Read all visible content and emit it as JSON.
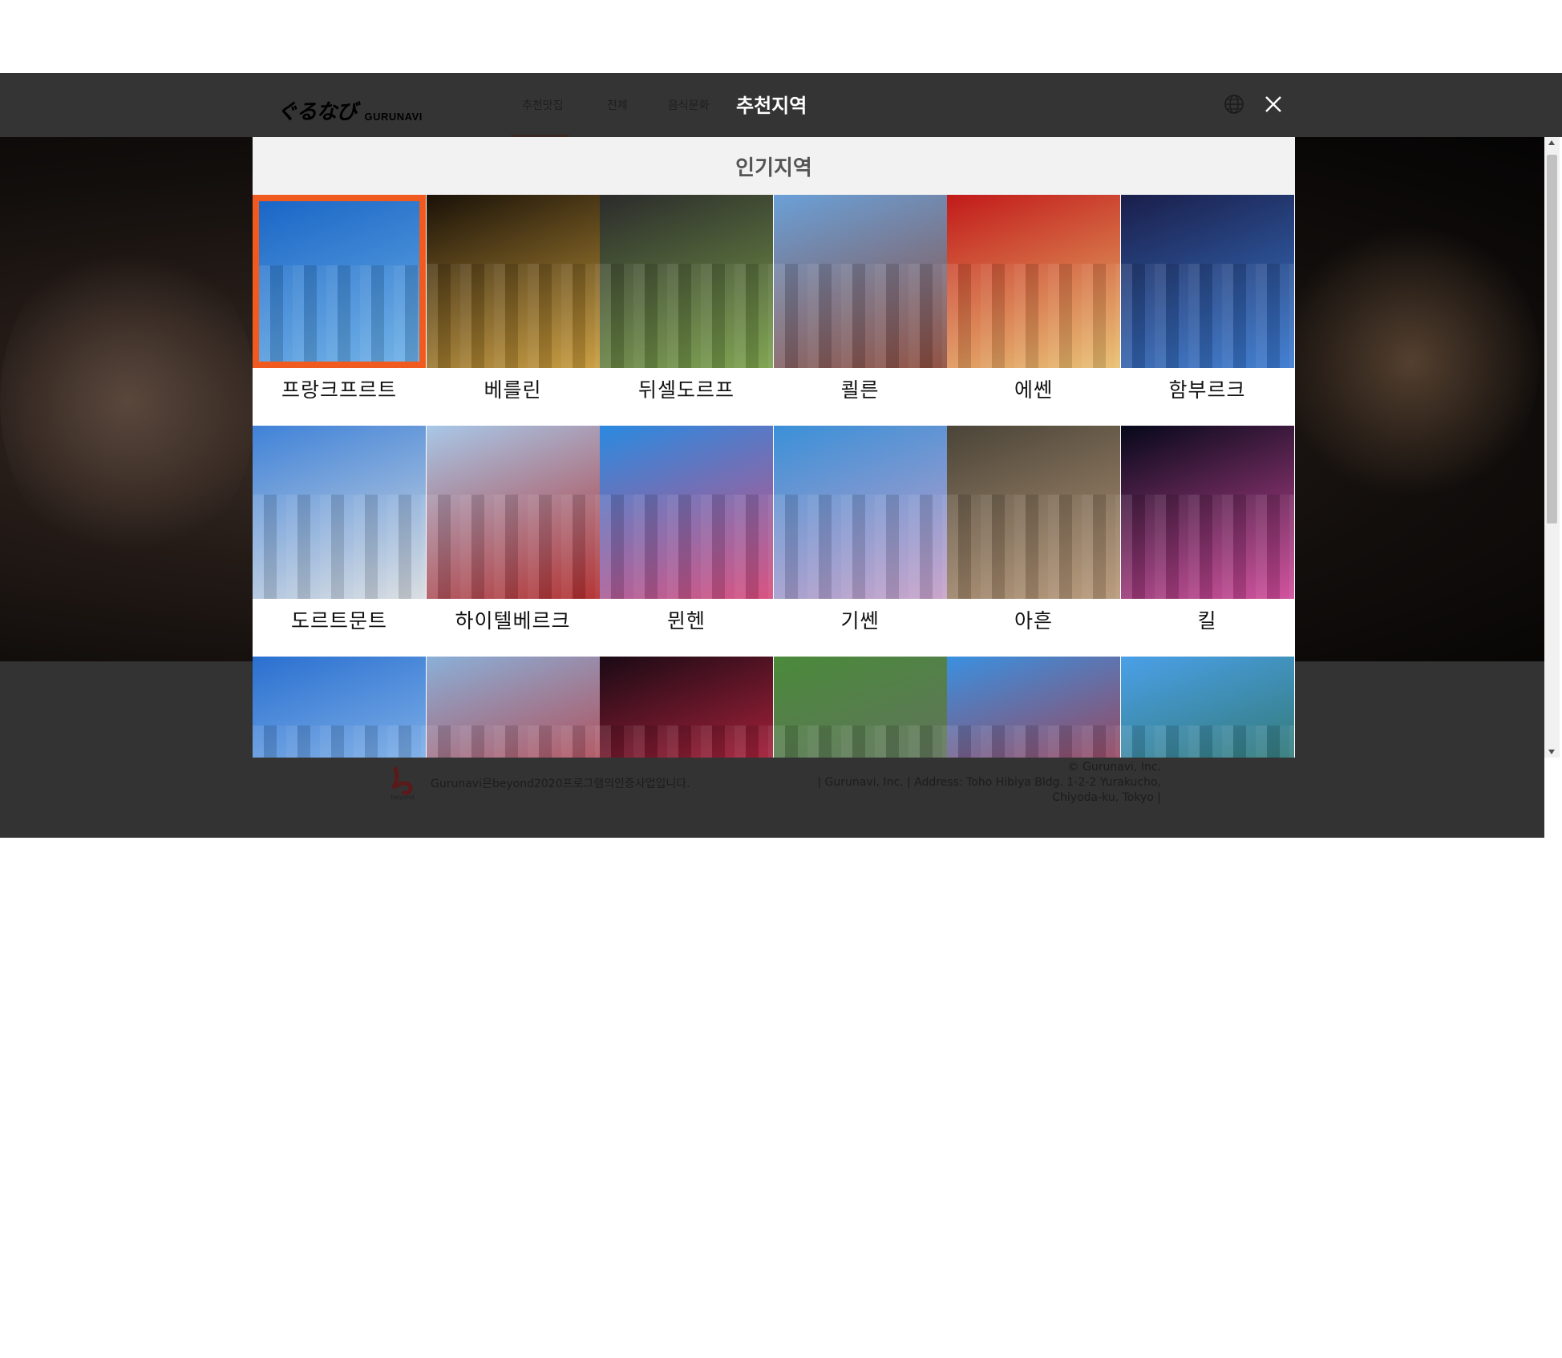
{
  "header": {
    "logo_jp": "ぐるなび",
    "logo_en": "GURUNAVI",
    "nav_tabs": [
      "추천맛집",
      "전체",
      "음식문화"
    ],
    "modal_title": "추천지역"
  },
  "panel": {
    "heading": "인기지역",
    "regions": [
      {
        "label": "프랑크프르트",
        "icon": "tower-photo",
        "colors": [
          "#1a66c6",
          "#6aaee6"
        ],
        "selected": true
      },
      {
        "label": "베를린",
        "icon": "clocktower-photo",
        "colors": [
          "#1a1208",
          "#c89a3a"
        ]
      },
      {
        "label": "뒤셀도르프",
        "icon": "crossing-photo",
        "colors": [
          "#2b2b2b",
          "#7aa04a"
        ]
      },
      {
        "label": "쾰른",
        "icon": "station-photo",
        "colors": [
          "#6aa0d8",
          "#8c4a3a"
        ]
      },
      {
        "label": "에쎈",
        "icon": "arcade-photo",
        "colors": [
          "#c21a1a",
          "#e8c070"
        ]
      },
      {
        "label": "함부르크",
        "icon": "tower-night-photo",
        "colors": [
          "#1a1e4a",
          "#3a7ad0"
        ]
      },
      {
        "label": "도르트문트",
        "icon": "street-photo",
        "colors": [
          "#3f82d8",
          "#d8dce0"
        ]
      },
      {
        "label": "하이텔베르크",
        "icon": "market-gate-photo",
        "colors": [
          "#a8c8e8",
          "#b02a2a"
        ]
      },
      {
        "label": "뮌헨",
        "icon": "signs-photo",
        "colors": [
          "#2a8ae0",
          "#d84a7a"
        ]
      },
      {
        "label": "기쎈",
        "icon": "shopping-street-photo",
        "colors": [
          "#3a90d8",
          "#c8a0c8"
        ]
      },
      {
        "label": "아흔",
        "icon": "fish-market-photo",
        "colors": [
          "#4a4438",
          "#b89878"
        ]
      },
      {
        "label": "킬",
        "icon": "harbor-night-photo",
        "colors": [
          "#05081a",
          "#d04a9a"
        ]
      },
      {
        "label": "",
        "icon": "sky-building-photo",
        "colors": [
          "#2a70d0",
          "#a0c8f0"
        ]
      },
      {
        "label": "",
        "icon": "mascot-photo",
        "colors": [
          "#8ab0d8",
          "#c02a2a"
        ]
      },
      {
        "label": "",
        "icon": "neon-night-photo",
        "colors": [
          "#1a0a14",
          "#e02a4a"
        ]
      },
      {
        "label": "",
        "icon": "old-town-photo",
        "colors": [
          "#4a8a3a",
          "#6a6a6a"
        ]
      },
      {
        "label": "",
        "icon": "port-tower-photo",
        "colors": [
          "#3a90e0",
          "#c02a2a"
        ]
      },
      {
        "label": "",
        "icon": "castle-photo",
        "colors": [
          "#4aa0e8",
          "#2a6a4a"
        ]
      }
    ]
  },
  "footer": {
    "beyond_logo_text": "beyond 2020",
    "beyond_text": "Gurunavi은beyond2020프로그램의인증사업입니다.",
    "copyright_lines": [
      "© Gurunavi, Inc.",
      "| Gurunavi, Inc. | Address: Toho Hibiya Bldg. 1-2-2 Yurakucho,",
      "Chiyoda-ku, Tokyo |"
    ]
  },
  "colors": {
    "header_bg": "#343434",
    "selected_border": "#f05a1e",
    "panel_heading_bg": "#f2f2f2"
  }
}
